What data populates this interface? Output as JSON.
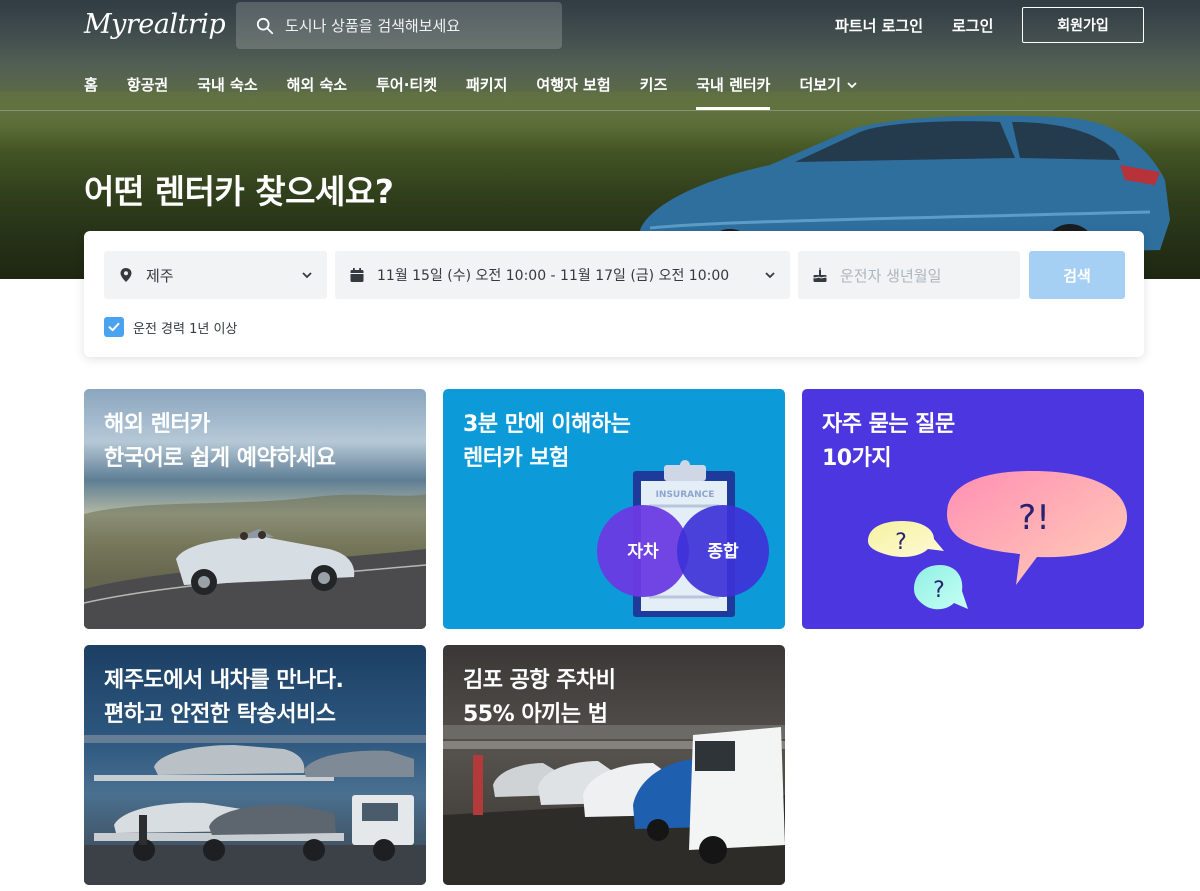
{
  "brand": {
    "logo": "Myrealtrip"
  },
  "header": {
    "search_placeholder": "도시나 상품을 검색해보세요",
    "partner_login": "파트너 로그인",
    "login": "로그인",
    "signup": "회원가입"
  },
  "nav": {
    "items": [
      {
        "label": "홈"
      },
      {
        "label": "항공권"
      },
      {
        "label": "국내 숙소"
      },
      {
        "label": "해외 숙소"
      },
      {
        "label": "투어·티켓"
      },
      {
        "label": "패키지"
      },
      {
        "label": "여행자 보험"
      },
      {
        "label": "키즈"
      },
      {
        "label": "국내 렌터카",
        "active": true
      },
      {
        "label": "더보기"
      }
    ],
    "active_index": 8
  },
  "hero": {
    "title": "어떤 렌터카 찾으세요?"
  },
  "search": {
    "location": "제주",
    "dates": "11월 15일 (수) 오전 10:00 - 11월 17일 (금) 오전 10:00",
    "birth_placeholder": "운전자 생년월일",
    "submit": "검색",
    "experience_label": "운전 경력 1년 이상",
    "experience_checked": true
  },
  "cards": [
    {
      "line1": "해외 렌터카",
      "line2": "한국어로 쉽게 예약하세요"
    },
    {
      "line1": "3분 만에 이해하는",
      "line2": "렌터카 보험",
      "badge": "INSURANCE",
      "left_circle": "자차",
      "right_circle": "종합"
    },
    {
      "line1": "자주 묻는 질문",
      "line2": "10가지",
      "bubble_big": "?!",
      "bubble_small": "?"
    },
    {
      "line1": "제주도에서 내차를 만나다.",
      "line2": "편하고 안전한 탁송서비스"
    },
    {
      "line1": "김포 공항 주차비",
      "line2": "55% 아끼는 법"
    }
  ],
  "colors": {
    "accent_blue": "#4aa3ee",
    "search_button_disabled": "#a5d0f4",
    "insurance_card": "#0d9ad9",
    "faq_card": "#4c36e0"
  }
}
